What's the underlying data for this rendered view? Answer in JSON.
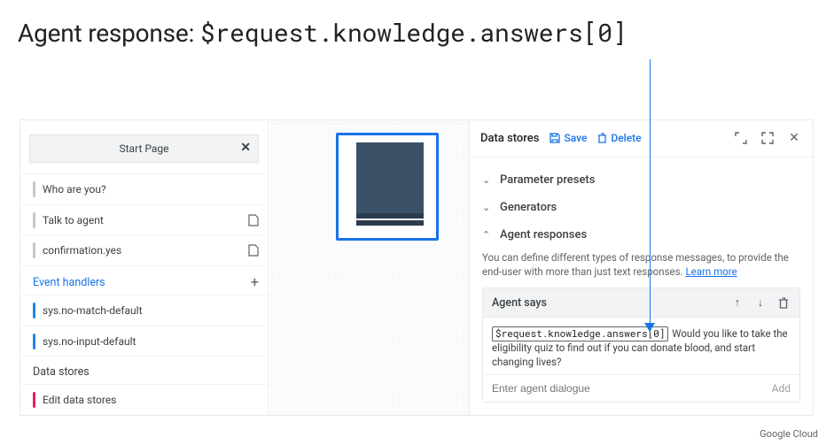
{
  "slide": {
    "title_prefix": "Agent response: ",
    "title_code": "$request.knowledge.answers[0]"
  },
  "sidebar": {
    "start_page_label": "Start Page",
    "routes": [
      {
        "label": "Who are you?"
      },
      {
        "label": "Talk to agent"
      },
      {
        "label": "confirmation.yes"
      }
    ],
    "event_handlers_label": "Event handlers",
    "event_handlers": [
      {
        "label": "sys.no-match-default"
      },
      {
        "label": "sys.no-input-default"
      }
    ],
    "data_stores_label": "Data stores",
    "data_stores": [
      {
        "label": "Edit data stores"
      }
    ]
  },
  "panel": {
    "title": "Data stores",
    "save_label": "Save",
    "delete_label": "Delete",
    "sections": {
      "parameter_presets": "Parameter presets",
      "generators": "Generators",
      "agent_responses": "Agent responses"
    },
    "helper_text_1": "You can define different types of response messages, to provide the end-user with more than just text responses. ",
    "helper_link": "Learn more",
    "agent_says_label": "Agent says",
    "agent_response_variable": "$request.knowledge.answers[0]",
    "agent_response_suffix": " Would you like to take the eligibility quiz to find out if you can donate blood, and start changing lives?",
    "dialogue_placeholder": "Enter agent dialogue",
    "add_label": "Add"
  },
  "footer": {
    "brand": "Google Cloud"
  }
}
